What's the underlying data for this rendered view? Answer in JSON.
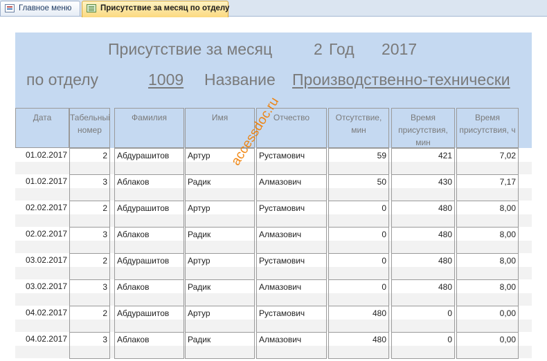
{
  "tabs": [
    {
      "label": "Главное меню",
      "icon": "menu-form-icon",
      "active": false
    },
    {
      "label": "Присутствие за месяц по отделу",
      "icon": "report-icon",
      "active": true
    }
  ],
  "header": {
    "title": "Присутствие за месяц",
    "month": "2",
    "year_label": "Год",
    "year": "2017",
    "dept_label": "по отделу",
    "dept": "1009",
    "name_label": "Название",
    "name": "Производственно-технически"
  },
  "columns": [
    "Дата",
    "Табельный номер",
    "Фамилия",
    "Имя",
    "Отчество",
    "Отсутствие, мин",
    "Время присутствия, мин",
    "Время присутствия, ч"
  ],
  "rows": [
    [
      "01.02.2017",
      "2",
      "Абдурашитов",
      "Артур",
      "Рустамович",
      "59",
      "421",
      "7,02"
    ],
    [
      "01.02.2017",
      "3",
      "Аблаков",
      "Радик",
      "Алмазович",
      "50",
      "430",
      "7,17"
    ],
    [
      "02.02.2017",
      "2",
      "Абдурашитов",
      "Артур",
      "Рустамович",
      "0",
      "480",
      "8,00"
    ],
    [
      "02.02.2017",
      "3",
      "Аблаков",
      "Радик",
      "Алмазович",
      "0",
      "480",
      "8,00"
    ],
    [
      "03.02.2017",
      "2",
      "Абдурашитов",
      "Артур",
      "Рустамович",
      "0",
      "480",
      "8,00"
    ],
    [
      "03.02.2017",
      "3",
      "Аблаков",
      "Радик",
      "Алмазович",
      "0",
      "480",
      "8,00"
    ],
    [
      "04.02.2017",
      "2",
      "Абдурашитов",
      "Артур",
      "Рустамович",
      "480",
      "0",
      "0,00"
    ],
    [
      "04.02.2017",
      "3",
      "Аблаков",
      "Радик",
      "Алмазович",
      "480",
      "0",
      "0,00"
    ]
  ],
  "watermark": "accessdoc.ru",
  "colors": {
    "header_bg": "#c5d9f1",
    "alt_row": "#f2f2f2",
    "active_tab": "#fbd980"
  }
}
